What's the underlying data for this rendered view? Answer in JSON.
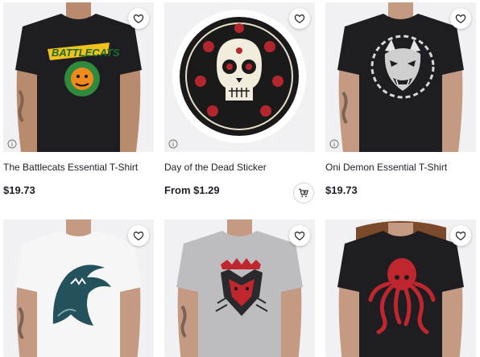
{
  "products": [
    {
      "title": "The Battlecats Essential T-Shirt",
      "price": "$19.73",
      "shirt_color": "#1e1e22",
      "design": "battlecats-logo"
    },
    {
      "title": "Day of the Dead Sticker",
      "price": "From $1.29",
      "design": "sugar-skull-sticker"
    },
    {
      "title": "Oni Demon Essential T-Shirt",
      "price": "$19.73",
      "shirt_color": "#1e1e22",
      "design": "oni-mask"
    },
    {
      "shirt_color": "#f4f4f4",
      "design": "shark-wave"
    },
    {
      "shirt_color": "#bdbdbf",
      "design": "red-wolf"
    },
    {
      "shirt_color": "#1e1e22",
      "design": "red-octopus"
    }
  ],
  "icons": {
    "favorite": "heart-icon",
    "info": "info-icon",
    "cart": "add-to-cart-icon"
  },
  "colors": {
    "text": "#1f1f29",
    "card_bg": "#f1f1f3"
  }
}
